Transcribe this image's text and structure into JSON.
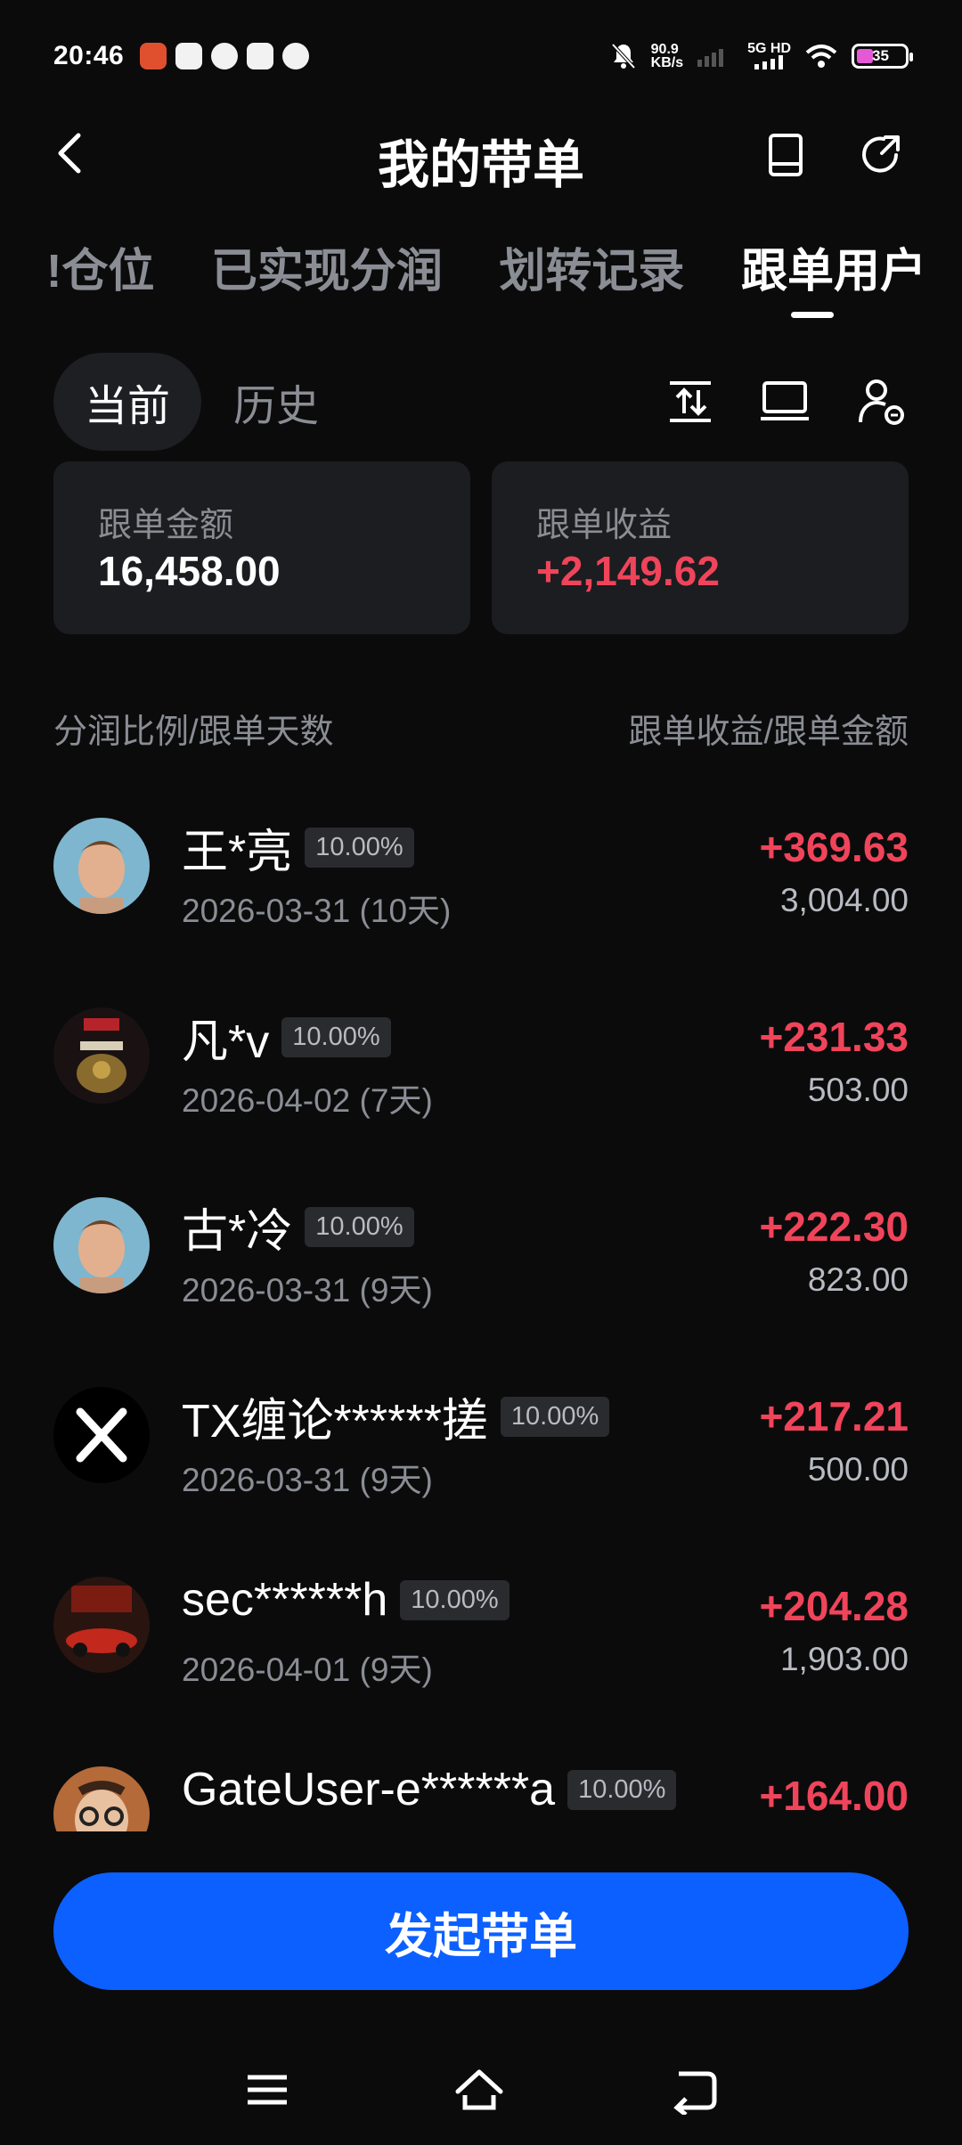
{
  "status_bar": {
    "time": "20:46",
    "speed": "90.9",
    "speed_unit": "KB/s",
    "network": "5G HD",
    "battery": "35"
  },
  "header": {
    "title": "我的带单"
  },
  "tabs": [
    {
      "label": "!仓位",
      "active": false
    },
    {
      "label": "已实现分润",
      "active": false
    },
    {
      "label": "划转记录",
      "active": false
    },
    {
      "label": "跟单用户",
      "active": true
    }
  ],
  "subtabs": {
    "current": "当前",
    "history": "历史"
  },
  "summary": {
    "follow_amount_label": "跟单金额",
    "follow_amount": "16,458.00",
    "follow_profit_label": "跟单收益",
    "follow_profit": "+2,149.62"
  },
  "columns": {
    "left": "分润比例/跟单天数",
    "right": "跟单收益/跟单金额"
  },
  "rows": [
    {
      "name": "王*亮",
      "ratio": "10.00%",
      "date": "2026-03-31 (10天)",
      "profit": "+369.63",
      "amount": "3,004.00",
      "avatar": "face-avatar"
    },
    {
      "name": "凡*v",
      "ratio": "10.00%",
      "date": "2026-04-02 (7天)",
      "profit": "+231.33",
      "amount": "503.00",
      "avatar": "poster-avatar"
    },
    {
      "name": "古*冷",
      "ratio": "10.00%",
      "date": "2026-03-31 (9天)",
      "profit": "+222.30",
      "amount": "823.00",
      "avatar": "face-avatar"
    },
    {
      "name": "TX缠论******搓",
      "ratio": "10.00%",
      "date": "2026-03-31 (9天)",
      "profit": "+217.21",
      "amount": "500.00",
      "avatar": "x-logo-avatar"
    },
    {
      "name": "sec******h",
      "ratio": "10.00%",
      "date": "2026-04-01 (9天)",
      "profit": "+204.28",
      "amount": "1,903.00",
      "avatar": "car-avatar"
    },
    {
      "name": "GateUser-e******a",
      "ratio": "10.00%",
      "date": "",
      "profit": "+164.00",
      "amount": "",
      "avatar": "glasses-avatar"
    }
  ],
  "cta": {
    "label": "发起带单"
  },
  "colors": {
    "accent": "#0b60ff",
    "profit": "#f0445a",
    "background": "#0b0b0c",
    "card": "#1c1d20"
  }
}
